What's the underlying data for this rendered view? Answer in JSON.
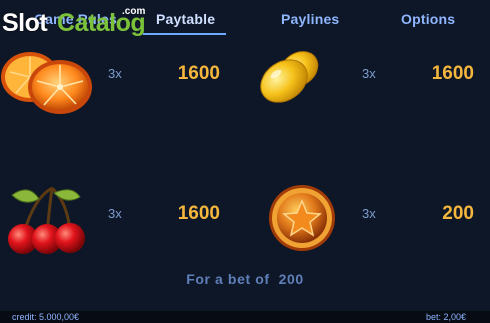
{
  "tabs": [
    {
      "label": "Game Rules"
    },
    {
      "label": "Paytable"
    },
    {
      "label": "Paylines"
    },
    {
      "label": "Options"
    }
  ],
  "watermark": {
    "brand_left": "Slot",
    "brand_right": "Catalog",
    "suffix": ".com"
  },
  "paytable": [
    {
      "symbol": "orange-icon",
      "multiplier": "3x",
      "payout": "1600"
    },
    {
      "symbol": "lemon-icon",
      "multiplier": "3x",
      "payout": "1600"
    },
    {
      "symbol": "cherries-icon",
      "multiplier": "3x",
      "payout": "1600"
    },
    {
      "symbol": "star-coin-icon",
      "multiplier": "3x",
      "payout": "200"
    }
  ],
  "bet_line": {
    "prefix": "For a bet of ",
    "value": "200"
  },
  "footer": {
    "credit": "credit: 5.000,00€",
    "bet": "bet: 2,00€"
  },
  "colors": {
    "background": "#0e1727",
    "payout": "#f4b63c",
    "tab": "#8fb6ff",
    "accent": "#7cc13a"
  }
}
